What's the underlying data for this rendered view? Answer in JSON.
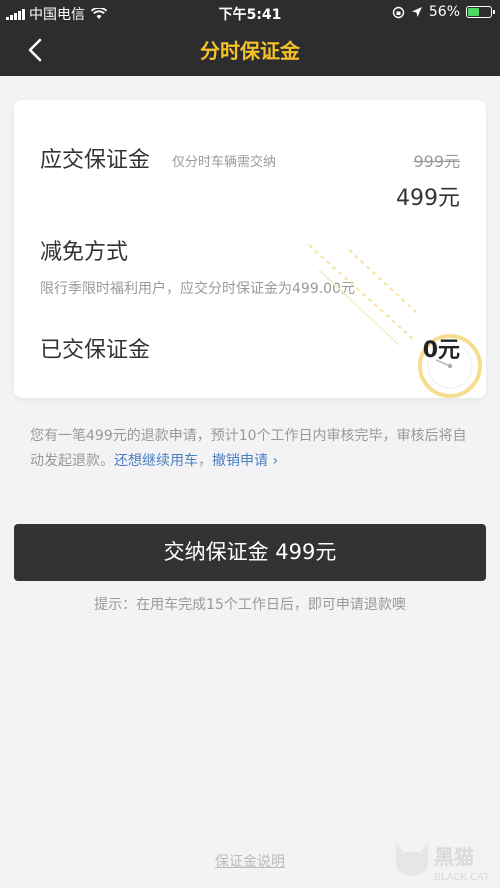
{
  "status_bar": {
    "carrier": "中国电信",
    "time": "下午5:41",
    "battery": "56%",
    "battery_level": 0.56
  },
  "nav": {
    "title": "分时保证金"
  },
  "card": {
    "deposit_label": "应交保证金",
    "deposit_hint": "仅分时车辆需交纳",
    "original_price": "999元",
    "current_price": "499元",
    "discount_label": "减免方式",
    "discount_desc": "限行季限时福利用户，应交分时保证金为499.00元",
    "paid_label": "已交保证金",
    "paid_amount": "0元"
  },
  "notice": {
    "text": "您有一笔499元的退款申请，预计10个工作日内审核完毕，审核后将自动发起退款。",
    "link_continue": "还想继续用车",
    "separator": "，",
    "link_cancel": "撤销申请",
    "chevron": "›"
  },
  "pay_button": {
    "label": "交纳保证金 499元"
  },
  "tip": "提示：在用车完成15个工作日后，即可申请退款噢",
  "footer_link": "保证金说明",
  "watermark": {
    "brand": "黑猫",
    "sub": "BLACK CAT"
  },
  "colors": {
    "header_bg": "#2d2d2f",
    "title": "#f5c229",
    "link": "#4a7fc1",
    "button_bg": "#333336"
  }
}
